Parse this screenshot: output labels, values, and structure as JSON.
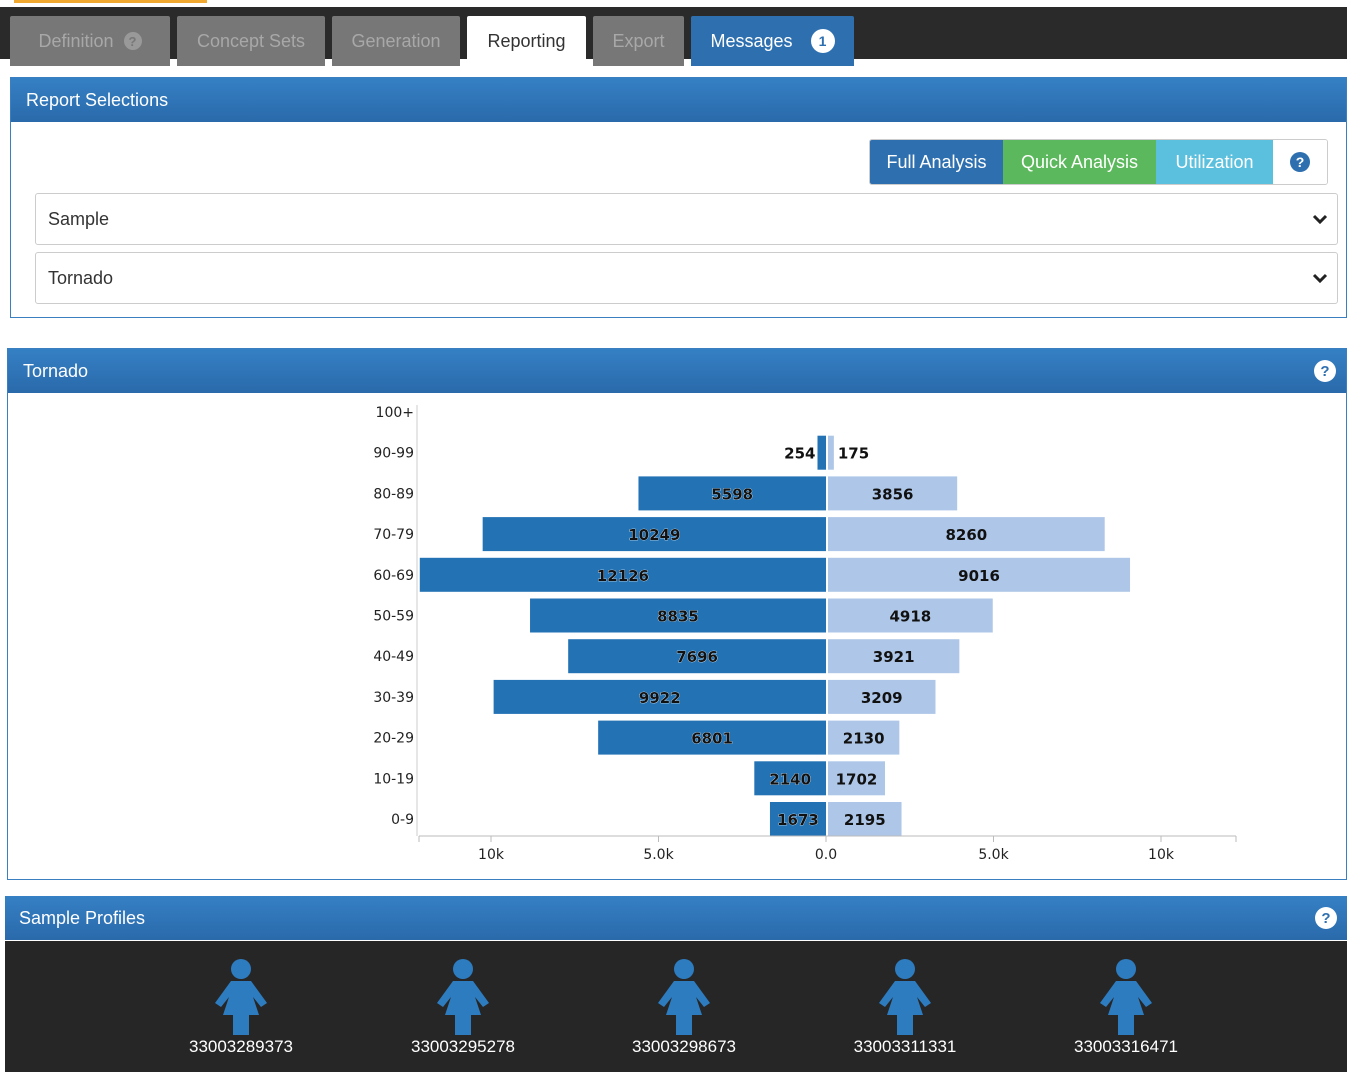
{
  "tabs": [
    {
      "label": "Definition",
      "left": 10,
      "width": 160,
      "state": "inactive",
      "help": true
    },
    {
      "label": "Concept Sets",
      "left": 177,
      "width": 148,
      "state": "inactive"
    },
    {
      "label": "Generation",
      "left": 332,
      "width": 128,
      "state": "inactive"
    },
    {
      "label": "Reporting",
      "left": 467,
      "width": 119,
      "state": "active"
    },
    {
      "label": "Export",
      "left": 593,
      "width": 91,
      "state": "inactive"
    },
    {
      "label": "Messages",
      "left": 691,
      "width": 163,
      "state": "messages",
      "badge": "1"
    }
  ],
  "report_selections": {
    "title": "Report Selections",
    "buttons": {
      "full": "Full Analysis",
      "quick": "Quick Analysis",
      "util": "Utilization",
      "help": "?"
    },
    "source_select": "Sample",
    "report_select": "Tornado"
  },
  "tornado_panel": {
    "title": "Tornado",
    "help": "?"
  },
  "profiles_panel": {
    "title": "Sample Profiles",
    "help": "?"
  },
  "colors": {
    "male": "#2272b4",
    "female": "#aec7e8",
    "header": "#2e6fb0"
  },
  "chart_data": {
    "type": "bar",
    "orientation": "tornado",
    "categories": [
      "0-9",
      "10-19",
      "20-29",
      "30-39",
      "40-49",
      "50-59",
      "60-69",
      "70-79",
      "80-89",
      "90-99",
      "100+"
    ],
    "series": [
      {
        "values": [
          1673,
          2140,
          6801,
          9922,
          7696,
          8835,
          12126,
          10249,
          5598,
          254,
          null
        ]
      },
      {
        "values": [
          2195,
          1702,
          2130,
          3209,
          3921,
          4918,
          9016,
          8260,
          3856,
          175,
          null
        ]
      }
    ],
    "xticks": [
      "10k",
      "5.0k",
      "0.0",
      "5.0k",
      "10k"
    ],
    "xlim": [
      -12126,
      12126
    ]
  },
  "profiles": [
    "33003289373",
    "33003295278",
    "33003298673",
    "33003311331",
    "33003316471"
  ]
}
